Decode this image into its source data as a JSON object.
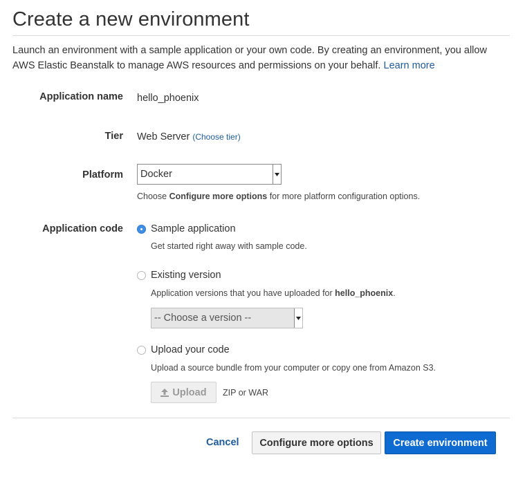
{
  "page": {
    "title": "Create a new environment",
    "intro_text": "Launch an environment with a sample application or your own code. By creating an environment, you allow AWS Elastic Beanstalk to manage AWS resources and permissions on your behalf.",
    "learn_more": "Learn more"
  },
  "form": {
    "application_name": {
      "label": "Application name",
      "value": "hello_phoenix"
    },
    "tier": {
      "label": "Tier",
      "value": "Web Server",
      "link": "(Choose tier)"
    },
    "platform": {
      "label": "Platform",
      "selected": "Docker",
      "help_prefix": "Choose ",
      "help_bold": "Configure more options",
      "help_suffix": " for more platform configuration options."
    },
    "application_code": {
      "label": "Application code",
      "options": [
        {
          "label": "Sample application",
          "description": "Get started right away with sample code.",
          "selected": true
        },
        {
          "label": "Existing version",
          "description_prefix": "Application versions that you have uploaded for ",
          "description_bold": "hello_phoenix",
          "description_suffix": ".",
          "selected": false
        },
        {
          "label": "Upload your code",
          "description": "Upload a source bundle from your computer or copy one from Amazon S3.",
          "selected": false
        }
      ],
      "version_select": {
        "selected": "-- Choose a version --"
      },
      "upload_button": "Upload",
      "upload_formats": "ZIP or WAR"
    }
  },
  "footer": {
    "cancel": "Cancel",
    "configure": "Configure more options",
    "create": "Create environment"
  },
  "colors": {
    "link": "#1d5b9f",
    "primary_button": "#0e6bd1",
    "radio_selected": "#3f8fe8"
  }
}
